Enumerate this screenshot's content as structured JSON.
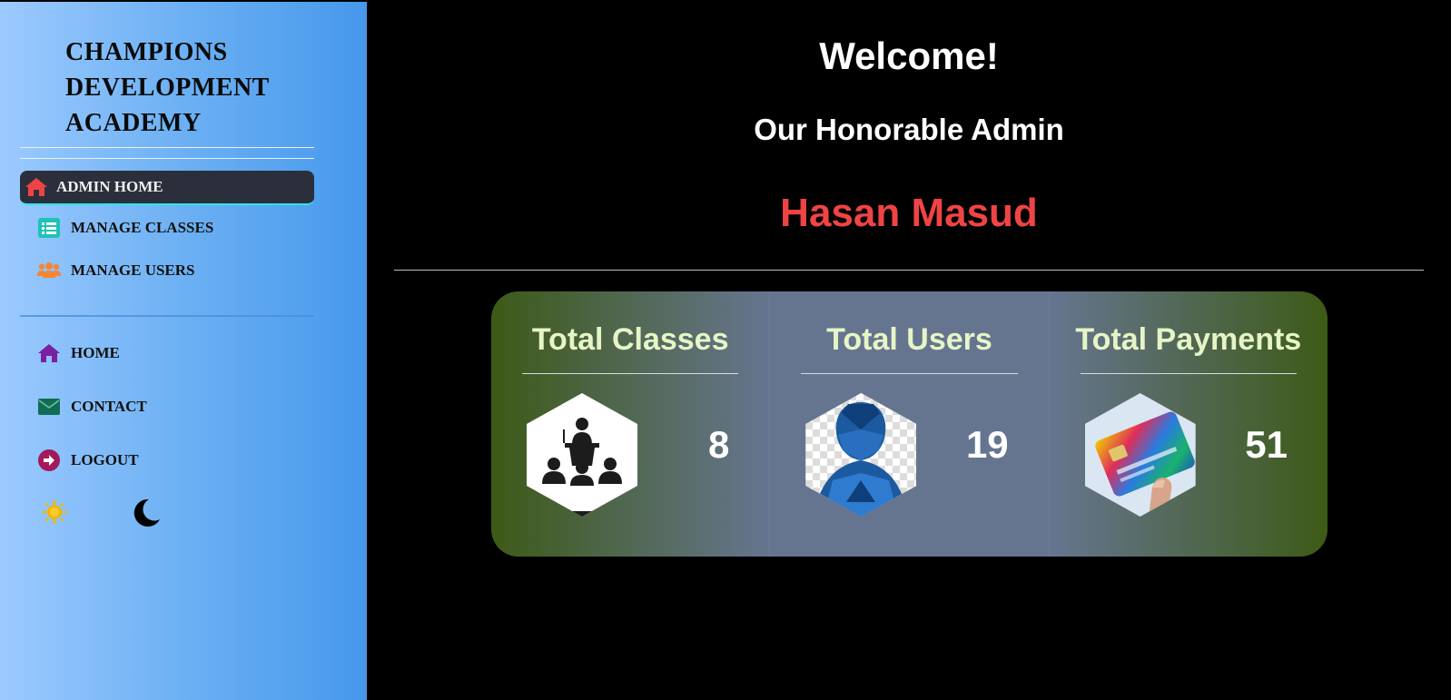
{
  "sidebar": {
    "brand_lines": [
      "CHAMPIONS",
      "DEVELOPMENT",
      "ACADEMY"
    ],
    "admin_nav": [
      {
        "label": "ADMIN HOME",
        "icon": "home-icon",
        "active": true
      },
      {
        "label": "MANAGE CLASSES",
        "icon": "list-icon"
      },
      {
        "label": "MANAGE USERS",
        "icon": "users-icon"
      }
    ],
    "general_nav": [
      {
        "label": "HOME",
        "icon": "home-icon"
      },
      {
        "label": "CONTACT",
        "icon": "envelope-icon"
      },
      {
        "label": "LOGOUT",
        "icon": "logout-icon"
      }
    ],
    "theme_toggles": [
      "sun-icon",
      "moon-icon"
    ]
  },
  "main": {
    "welcome": "Welcome!",
    "subtitle": "Our Honorable Admin",
    "admin_name": "Hasan Masud",
    "stats": [
      {
        "title": "Total Classes",
        "value": "8",
        "icon": "classroom-icon"
      },
      {
        "title": "Total Users",
        "value": "19",
        "icon": "user-avatar-icon"
      },
      {
        "title": "Total Payments",
        "value": "51",
        "icon": "credit-card-icon"
      }
    ]
  },
  "colors": {
    "sidebar_gradient_start": "#9ccaff",
    "sidebar_gradient_end": "#4698ec",
    "active_nav_bg": "#2b2f3c",
    "active_nav_border": "#2ee6e6",
    "admin_name": "#ef4444",
    "stat_title": "#e6f5c6",
    "stats_green": "#3d5a16",
    "stats_slate": "#66758f"
  }
}
